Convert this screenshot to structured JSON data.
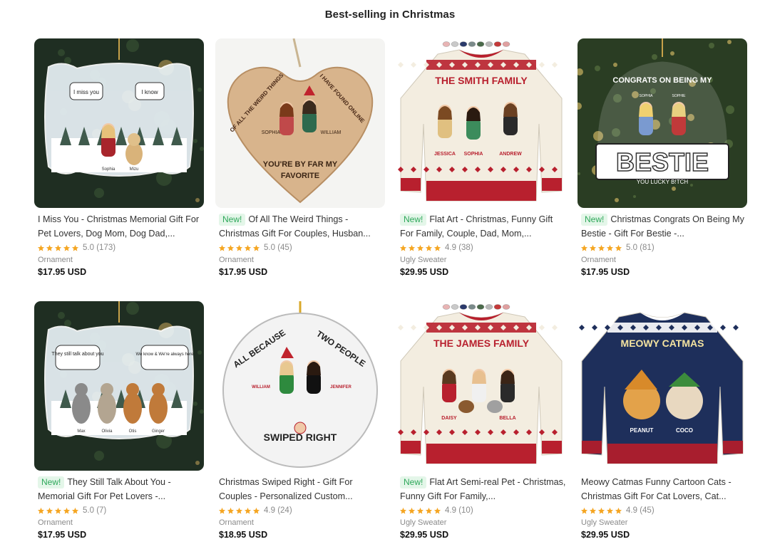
{
  "section": {
    "title": "Best-selling in Christmas"
  },
  "colors": {
    "star": "#f5a623",
    "new_bg": "#e4f6e9",
    "new_fg": "#2ea85a",
    "sweater_red": "#b8202e",
    "sweater_navy": "#1e2f5b"
  },
  "products": [
    {
      "is_new": false,
      "new_label": "",
      "title": "I Miss You - Christmas Memorial Gift For Pet Lovers, Dog Mom, Dog Dad,...",
      "rating": "5.0",
      "reviews": "(173)",
      "category": "Ornament",
      "price": "$17.95 USD",
      "image": {
        "kind": "ornament-acrylic",
        "bubble_left": "I miss you",
        "bubble_right": "I know",
        "names": [
          "Sophia",
          "Mizu"
        ]
      }
    },
    {
      "is_new": true,
      "new_label": "New!",
      "title": "Of All The Weird Things - Christmas Gift For Couples, Husban...",
      "rating": "5.0",
      "reviews": "(45)",
      "category": "Ornament",
      "price": "$17.95 USD",
      "image": {
        "kind": "heart-wood",
        "arc_left": "OF ALL THE WEIRD THINGS",
        "arc_right": "I HAVE FOUND ONLINE",
        "names": [
          "SOPHIA",
          "WILLIAM"
        ],
        "bottom1": "YOU'RE BY FAR MY",
        "bottom2": "FAVORITE"
      }
    },
    {
      "is_new": true,
      "new_label": "New!",
      "title": "Flat Art - Christmas, Funny Gift For Family, Couple, Dad, Mom,...",
      "rating": "4.9",
      "reviews": "(38)",
      "category": "Ugly Sweater",
      "price": "$29.95 USD",
      "image": {
        "kind": "sweater-red",
        "heading": "THE SMITH FAMILY",
        "names": [
          "JESSICA",
          "SOPHIA",
          "ANDREW"
        ]
      }
    },
    {
      "is_new": true,
      "new_label": "New!",
      "title": "Christmas Congrats On Being My Bestie - Gift For Bestie -...",
      "rating": "5.0",
      "reviews": "(81)",
      "category": "Ornament",
      "price": "$17.95 USD",
      "image": {
        "kind": "bestie",
        "arc": "CONGRATS ON BEING MY",
        "big": "BESTIE",
        "sub": "YOU LUCKY B!TCH",
        "names": [
          "SOPHIA",
          "SOPHIE"
        ]
      }
    },
    {
      "is_new": true,
      "new_label": "New!",
      "title": "They Still Talk About You - Memorial Gift For Pet Lovers -...",
      "rating": "5.0",
      "reviews": "(7)",
      "category": "Ornament",
      "price": "$17.95 USD",
      "image": {
        "kind": "ornament-pets",
        "bubble_left": "They still talk about you",
        "bubble_right": "We know & We're always here",
        "names": [
          "Max",
          "Olivia",
          "Otis",
          "Ginger"
        ]
      }
    },
    {
      "is_new": false,
      "new_label": "",
      "title": "Christmas Swiped Right - Gift For Couples - Personalized Custom...",
      "rating": "4.9",
      "reviews": "(24)",
      "category": "Ornament",
      "price": "$18.95 USD",
      "image": {
        "kind": "circle-ceramic",
        "arc_left": "ALL BECAUSE",
        "arc_right": "TWO PEOPLE",
        "names": [
          "WILLIAM",
          "JENNIFER"
        ],
        "bottom": "SWIPED RIGHT"
      }
    },
    {
      "is_new": true,
      "new_label": "New!",
      "title": "Flat Art Semi-real Pet - Christmas, Funny Gift For Family,...",
      "rating": "4.9",
      "reviews": "(10)",
      "category": "Ugly Sweater",
      "price": "$29.95 USD",
      "image": {
        "kind": "sweater-red",
        "heading": "THE JAMES FAMILY",
        "names": [
          "DAISY",
          "BELLA"
        ]
      }
    },
    {
      "is_new": false,
      "new_label": "",
      "title": "Meowy Catmas Funny Cartoon Cats - Christmas Gift For Cat Lovers, Cat...",
      "rating": "4.9",
      "reviews": "(45)",
      "category": "Ugly Sweater",
      "price": "$29.95 USD",
      "image": {
        "kind": "sweater-navy",
        "heading": "MEOWY CATMAS",
        "names": [
          "PEANUT",
          "COCO"
        ]
      }
    }
  ]
}
